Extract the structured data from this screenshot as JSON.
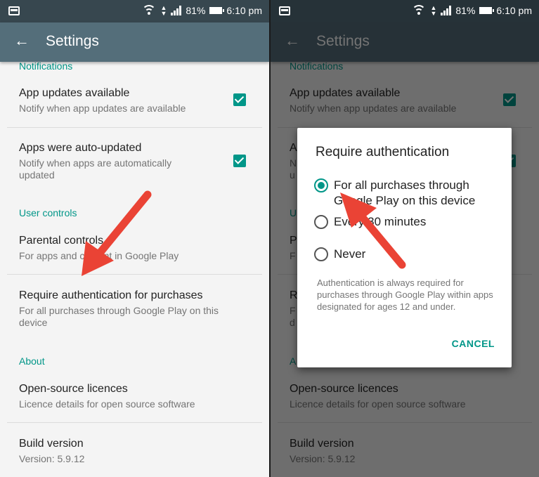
{
  "status_bar": {
    "battery": "81%",
    "time": "6:10 pm"
  },
  "app_bar": {
    "title": "Settings"
  },
  "sections": {
    "notifications": "Notifications",
    "user_controls": "User controls",
    "about": "About"
  },
  "items": {
    "app_updates": {
      "title": "App updates available",
      "subtitle": "Notify when app updates are available",
      "checked": true
    },
    "auto_updated": {
      "title": "Apps were auto-updated",
      "subtitle": "Notify when apps are automatically updated",
      "checked": true
    },
    "parental": {
      "title": "Parental controls",
      "subtitle": "For apps and content in Google Play"
    },
    "require_auth": {
      "title": "Require authentication for purchases",
      "subtitle": "For all purchases through Google Play on this device"
    },
    "licences": {
      "title": "Open-source licences",
      "subtitle": "Licence details for open source software"
    },
    "build": {
      "title": "Build version",
      "subtitle": "Version: 5.9.12"
    }
  },
  "right_visible": {
    "auto_updated_title": "A",
    "auto_updated_sub1": "N",
    "auto_updated_sub2": "u",
    "user_controls": "U",
    "parental_title": "P",
    "parental_sub": "F",
    "require_title": "R",
    "require_sub1": "F",
    "require_sub2": "d",
    "about": "A"
  },
  "dialog": {
    "title": "Require authentication",
    "options": [
      {
        "label": "For all purchases through Google Play on this device",
        "selected": true
      },
      {
        "label": "Every 30 minutes",
        "selected": false
      },
      {
        "label": "Never",
        "selected": false
      }
    ],
    "note": "Authentication is always required for purchases through Google Play within apps designated for ages 12 and under.",
    "cancel": "CANCEL"
  },
  "colors": {
    "accent": "#009688",
    "app_bar": "#546e7a",
    "status_bar": "#37474f",
    "arrow": "#ea4335"
  }
}
